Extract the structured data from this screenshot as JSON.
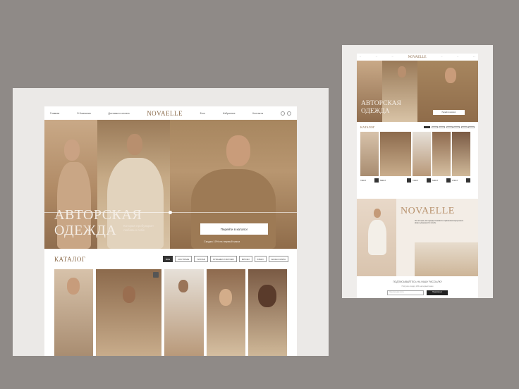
{
  "left": {
    "nav": {
      "items": [
        "Главная",
        "О Компании",
        "Доставка и оплата",
        "Блог",
        "Избранное",
        "Контакты"
      ],
      "logo": "NOVAELLE"
    },
    "hero": {
      "title_line1": "АВТОРСКАЯ",
      "title_line2": "ОДЕЖДА",
      "subtitle": "Которая пробуждает любовь к себе",
      "button_label": "Перейти в каталог",
      "discount_note": "Скидка 10% на первый заказ"
    },
    "catalog": {
      "title": "КАТАЛОГ",
      "filters": [
        "ВСЕ",
        "КОСТЮМЫ",
        "ПЛАТЬЯ",
        "РУБАШКИ И БЛУЗКИ",
        "БРЮКИ",
        "ЮБКИ",
        "АКСЕССУАРЫ"
      ]
    }
  },
  "right": {
    "nav_logo": "NOVAELLE",
    "hero": {
      "title_line1": "АВТОРСКАЯ",
      "title_line2": "ОДЕЖДА",
      "button_label": "Перейти в каталог"
    },
    "catalog_title": "КАТАЛОГ",
    "prices": [
      "7290 ₽",
      "5890 ₽",
      "7290 ₽",
      "5290 ₽",
      "4790 ₽"
    ],
    "about": {
      "brand": "NOVAELLE",
      "text": "Это история, как одежда становится отражением внутреннего мира и уверенности в себе."
    },
    "newsletter": {
      "heading": "ПОДПИСЫВАЙТЕСЬ НА НАШУ РАССЫЛКУ",
      "note": "Получите скидку 10% на первый заказ",
      "placeholder": "Электронная почта",
      "button_label": "Подписаться"
    }
  }
}
